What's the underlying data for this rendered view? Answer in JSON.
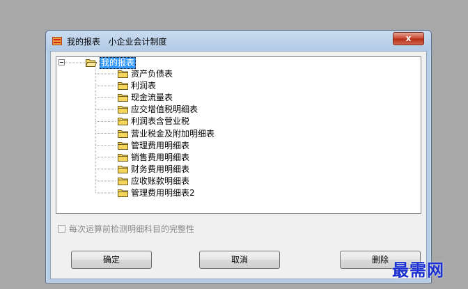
{
  "window": {
    "title": "我的报表   小企业会计制度",
    "close_label": "x"
  },
  "tree": {
    "root": "我的报表",
    "items": [
      "资产负债表",
      "利润表",
      "现金流量表",
      "应交增值税明细表",
      "利润表含营业税",
      "营业税金及附加明细表",
      "管理费用明细表",
      "销售费用明细表",
      "财务费用明细表",
      "应收账款明细表",
      "管理费用明细表2"
    ]
  },
  "option": {
    "checkbox_label": "每次运算前检测明细科目的完整性",
    "checked": false
  },
  "buttons": {
    "ok": "确定",
    "cancel": "取消",
    "delete": "删除"
  },
  "watermark": "最需网",
  "colors": {
    "desktop": "#a8a8a8",
    "frame": "#b6cde6",
    "selection": "#3399ff",
    "close": "#c9462f",
    "folder": "#f5d55c",
    "watermark": "#1a2fd1"
  }
}
